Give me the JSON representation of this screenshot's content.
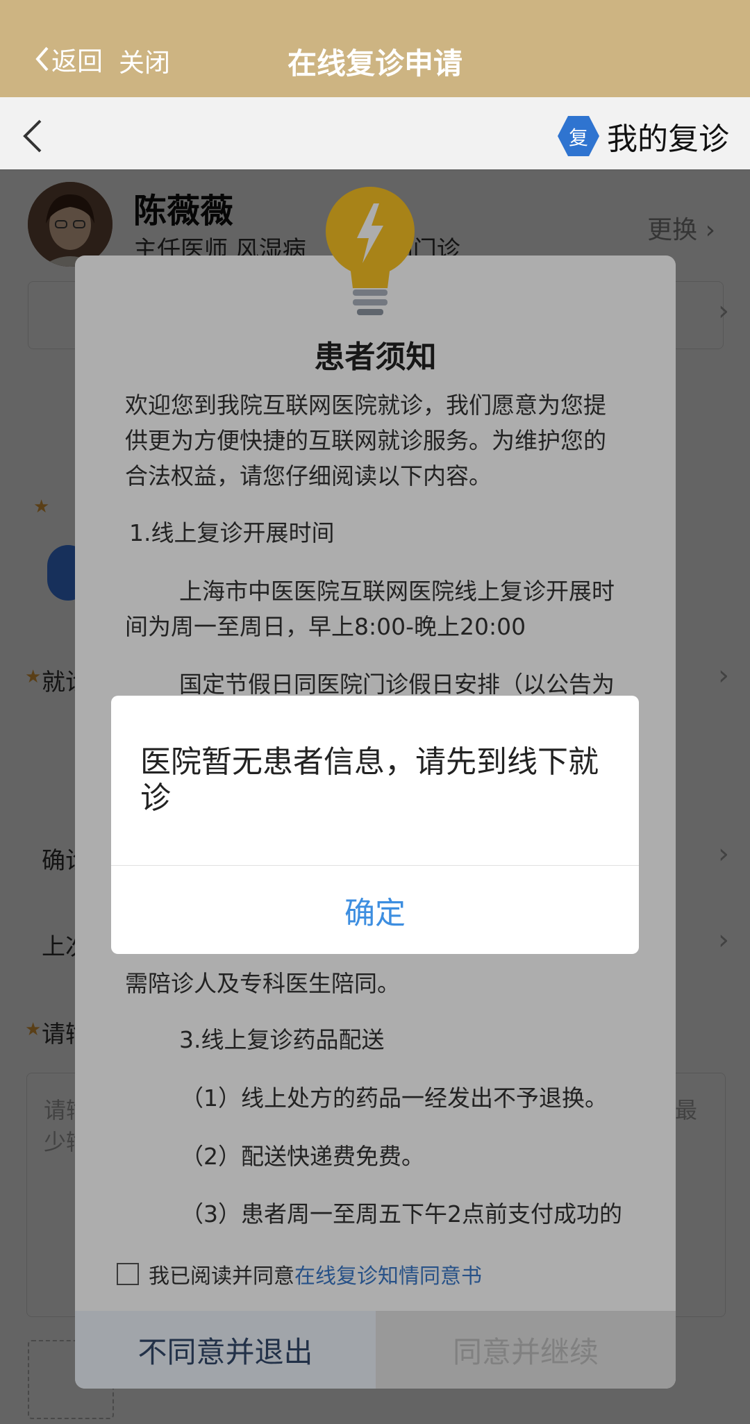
{
  "header": {
    "back_label": "返回",
    "close_label": "关闭",
    "title": "在线复诊申请"
  },
  "navbar": {
    "badge_char": "复",
    "mine_label": "我的复诊"
  },
  "doctor": {
    "name": "陈薇薇",
    "title": "主任医师  风湿病",
    "title_tail": "网门诊",
    "change_label": "更换"
  },
  "form": {
    "row1": "就诊",
    "row2": "确诊",
    "row3": "上次",
    "row4": "请输",
    "placeholder_a": "请输",
    "placeholder_b": "少输",
    "tail_char": "最"
  },
  "notice": {
    "title": "患者须知",
    "intro": "欢迎您到我院互联网医院就诊，我们愿意为您提供更为方便快捷的互联网就诊服务。为维护您的合法权益，请您仔细阅读以下内容。",
    "s1_heading": "1.线上复诊开展时间",
    "s1_p1": "上海市中医医院互联网医院线上复诊开展时间为周一至周日，早上8:00-晚上20:00",
    "s1_p2": "国定节假日同医院门诊假日安排（以公告为",
    "s2_tail": "需陪诊人及专科医生陪同。",
    "s3_heading": "3.线上复诊药品配送",
    "s3_i1": "（1）线上处方的药品一经发出不予退换。",
    "s3_i2": "（2）配送快递费免费。",
    "s3_i3": "（3）患者周一至周五下午2点前支付成功的",
    "consent_text": "我已阅读并同意",
    "consent_link": "在线复诊知情同意书",
    "disagree_label": "不同意并退出",
    "agree_label": "同意并继续"
  },
  "alert": {
    "message": "医院暂无患者信息，请先到线下就诊",
    "ok_label": "确定"
  },
  "colors": {
    "header_bg": "#cdb482",
    "link_blue": "#3a78c8",
    "ok_blue": "#3d8ee0",
    "badge_blue": "#2f74d0"
  }
}
